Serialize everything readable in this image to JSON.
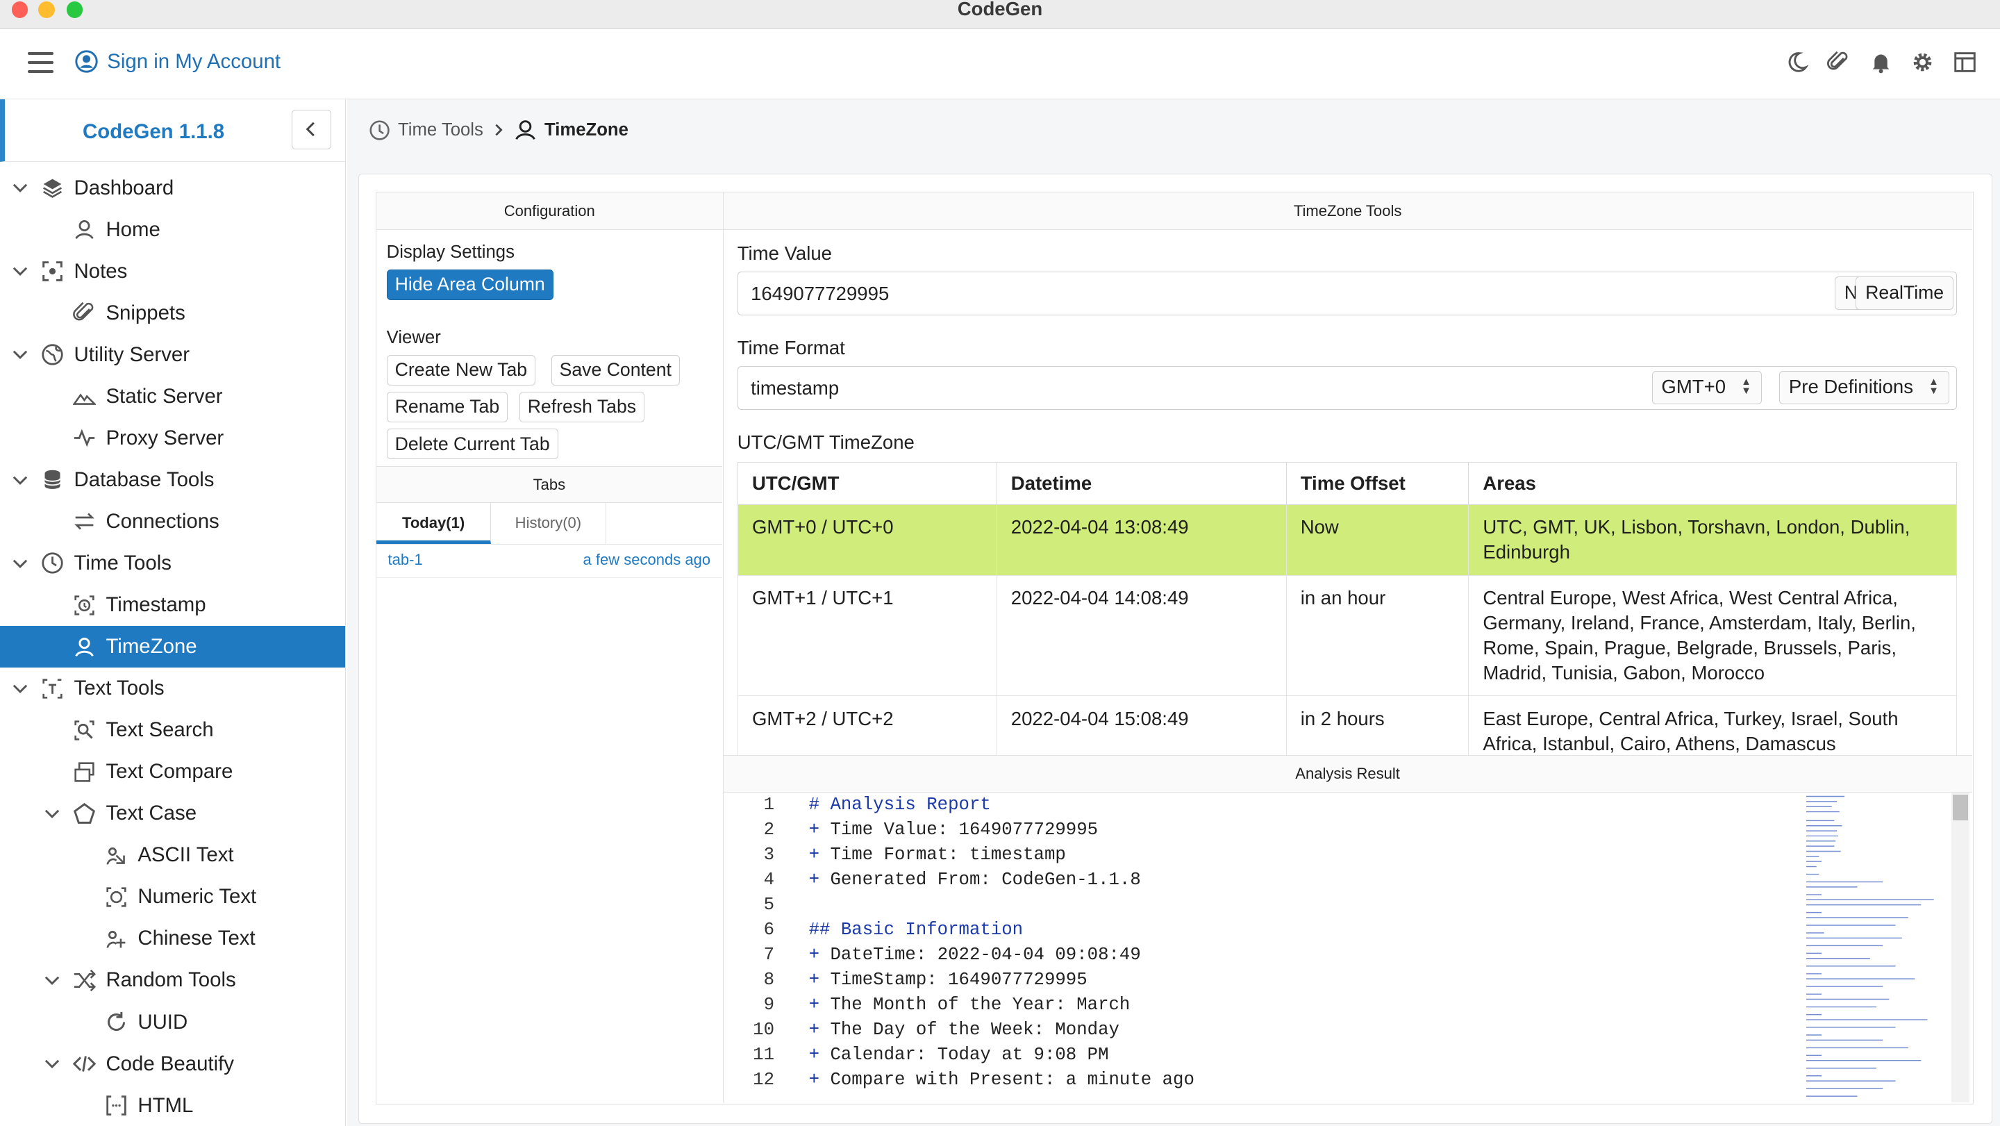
{
  "window": {
    "title": "CodeGen"
  },
  "topbar": {
    "signin_label": "Sign in My Account",
    "icons": [
      "moon-icon",
      "paperclip-icon",
      "bell-icon",
      "gear-icon",
      "layout-icon"
    ]
  },
  "sidebar": {
    "brand": "CodeGen 1.1.8",
    "items": [
      {
        "label": "Dashboard",
        "level": 0,
        "icon": "layers-icon",
        "expanded": true
      },
      {
        "label": "Home",
        "level": 1,
        "icon": "home-icon"
      },
      {
        "label": "Notes",
        "level": 0,
        "icon": "notes-icon",
        "expanded": true
      },
      {
        "label": "Snippets",
        "level": 1,
        "icon": "paperclip-icon"
      },
      {
        "label": "Utility Server",
        "level": 0,
        "icon": "globe-icon",
        "expanded": true
      },
      {
        "label": "Static Server",
        "level": 1,
        "icon": "mountain-icon"
      },
      {
        "label": "Proxy Server",
        "level": 1,
        "icon": "pulse-icon"
      },
      {
        "label": "Database Tools",
        "level": 0,
        "icon": "database-icon",
        "expanded": true
      },
      {
        "label": "Connections",
        "level": 1,
        "icon": "swap-icon"
      },
      {
        "label": "Time Tools",
        "level": 0,
        "icon": "clock-icon",
        "expanded": true
      },
      {
        "label": "Timestamp",
        "level": 1,
        "icon": "timestamp-icon"
      },
      {
        "label": "TimeZone",
        "level": 1,
        "icon": "timezone-icon",
        "active": true
      },
      {
        "label": "Text Tools",
        "level": 0,
        "icon": "text-icon",
        "expanded": true
      },
      {
        "label": "Text Search",
        "level": 1,
        "icon": "search-icon"
      },
      {
        "label": "Text Compare",
        "level": 1,
        "icon": "compare-icon"
      },
      {
        "label": "Text Case",
        "level": 1,
        "icon": "pentagon-icon",
        "expanded": true
      },
      {
        "label": "ASCII Text",
        "level": 2,
        "icon": "ascii-icon"
      },
      {
        "label": "Numeric Text",
        "level": 2,
        "icon": "numeric-icon"
      },
      {
        "label": "Chinese Text",
        "level": 2,
        "icon": "chinese-icon"
      },
      {
        "label": "Random Tools",
        "level": 1,
        "icon": "shuffle-icon",
        "expanded": true
      },
      {
        "label": "UUID",
        "level": 2,
        "icon": "refresh-icon"
      },
      {
        "label": "Code Beautify",
        "level": 1,
        "icon": "code-icon",
        "expanded": true
      },
      {
        "label": "HTML",
        "level": 2,
        "icon": "brackets-icon"
      }
    ]
  },
  "breadcrumb": {
    "parent": "Time Tools",
    "current": "TimeZone"
  },
  "config": {
    "header": "Configuration",
    "display_settings_label": "Display Settings",
    "hide_area_button": "Hide Area Column",
    "viewer_label": "Viewer",
    "viewer_buttons": {
      "create_tab": "Create New Tab",
      "save_content": "Save Content",
      "rename_tab": "Rename Tab",
      "refresh_tabs": "Refresh Tabs",
      "delete_tab": "Delete Current Tab"
    },
    "tabs_header": "Tabs",
    "tab_today": "Today(1)",
    "tab_history": "History(0)",
    "tab_entry": {
      "name": "tab-1",
      "time": "a few seconds ago"
    }
  },
  "tools": {
    "header": "TimeZone Tools",
    "time_value_label": "Time Value",
    "time_value": "1649077729995",
    "now_button": "Now",
    "realtime_button": "RealTime",
    "time_format_label": "Time Format",
    "time_format": "timestamp",
    "gmt_select": "GMT+0",
    "predef_select": "Pre Definitions",
    "table_label": "UTC/GMT TimeZone",
    "columns": [
      "UTC/GMT",
      "Datetime",
      "Time Offset",
      "Areas"
    ],
    "rows": [
      {
        "utc": "GMT+0 / UTC+0",
        "datetime": "2022-04-04 13:08:49",
        "offset": "Now",
        "areas": "UTC, GMT, UK, Lisbon, Torshavn, London, Dublin, Edinburgh"
      },
      {
        "utc": "GMT+1 / UTC+1",
        "datetime": "2022-04-04 14:08:49",
        "offset": "in an hour",
        "areas": "Central Europe, West Africa, West Central Africa, Germany, Ireland, France, Amsterdam, Italy, Berlin, Rome, Spain, Prague, Belgrade, Brussels, Paris, Madrid, Tunisia, Gabon, Morocco"
      },
      {
        "utc": "GMT+2 / UTC+2",
        "datetime": "2022-04-04 15:08:49",
        "offset": "in 2 hours",
        "areas": "East Europe, Central Africa, Turkey, Israel, South Africa, Istanbul, Cairo, Athens, Damascus"
      }
    ]
  },
  "result": {
    "header": "Analysis Result",
    "lines": [
      "# Analysis Report",
      "+ Time Value: 1649077729995",
      "+ Time Format: timestamp",
      "+ Generated From: CodeGen-1.1.8",
      "",
      "## Basic Information",
      "+ DateTime: 2022-04-04 09:08:49",
      "+ TimeStamp: 1649077729995",
      "+ The Month of the Year: March",
      "+ The Day of the Week: Monday",
      "+ Calendar: Today at 9:08 PM",
      "+ Compare with Present: a minute ago"
    ]
  }
}
